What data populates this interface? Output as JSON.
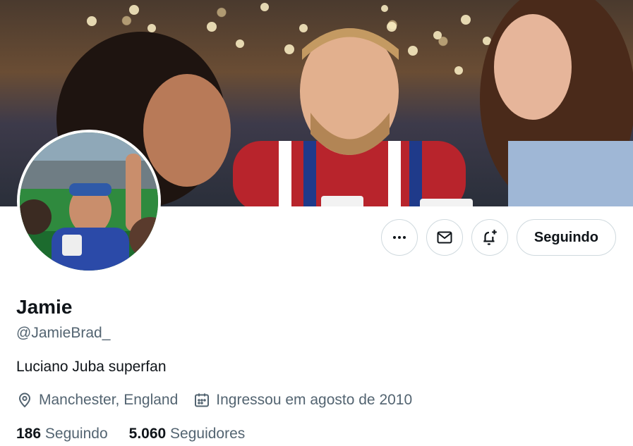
{
  "profile": {
    "name": "Jamie",
    "handle": "@JamieBrad_",
    "bio": "Luciano Juba superfan",
    "location": "Manchester, England",
    "joined": "Ingressou em agosto de 2010"
  },
  "actions": {
    "more_icon": "more-horizontal-icon",
    "message_icon": "mail-icon",
    "notify_icon": "bell-plus-icon",
    "follow_label": "Seguindo"
  },
  "stats": {
    "following_count": "186",
    "following_label": "Seguindo",
    "followers_count": "5.060",
    "followers_label": "Seguidores"
  },
  "colors": {
    "text": "#0f1419",
    "secondary": "#536471",
    "border": "#cfd9de"
  }
}
